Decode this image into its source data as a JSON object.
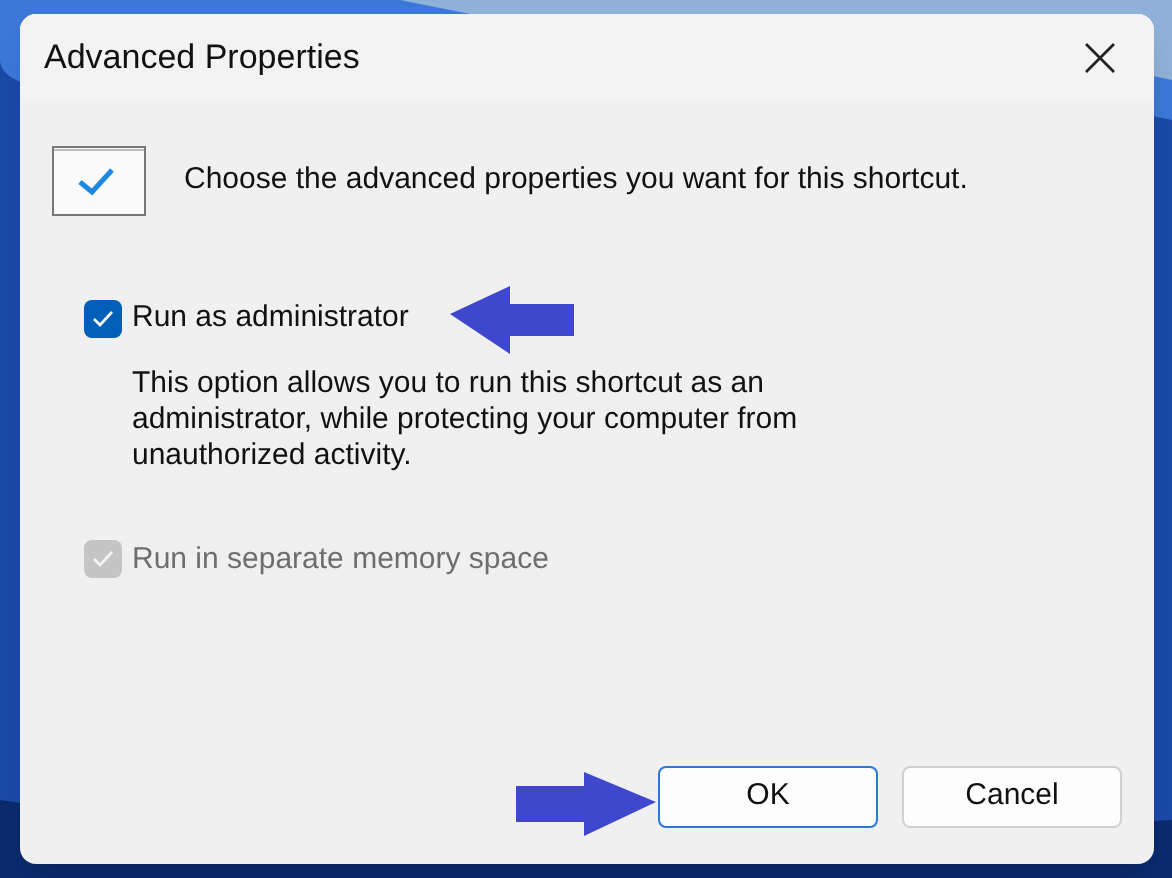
{
  "window": {
    "title": "Advanced Properties"
  },
  "prompt": "Choose the advanced properties you want for this shortcut.",
  "options": [
    {
      "label": "Run as administrator",
      "checked": true,
      "disabled": false,
      "description": "This option allows you to run this shortcut as an administrator, while protecting your computer from unauthorized activity."
    },
    {
      "label": "Run in separate memory space",
      "checked": true,
      "disabled": true
    }
  ],
  "buttons": [
    {
      "label": "OK",
      "default": true
    },
    {
      "label": "Cancel",
      "default": false
    }
  ]
}
